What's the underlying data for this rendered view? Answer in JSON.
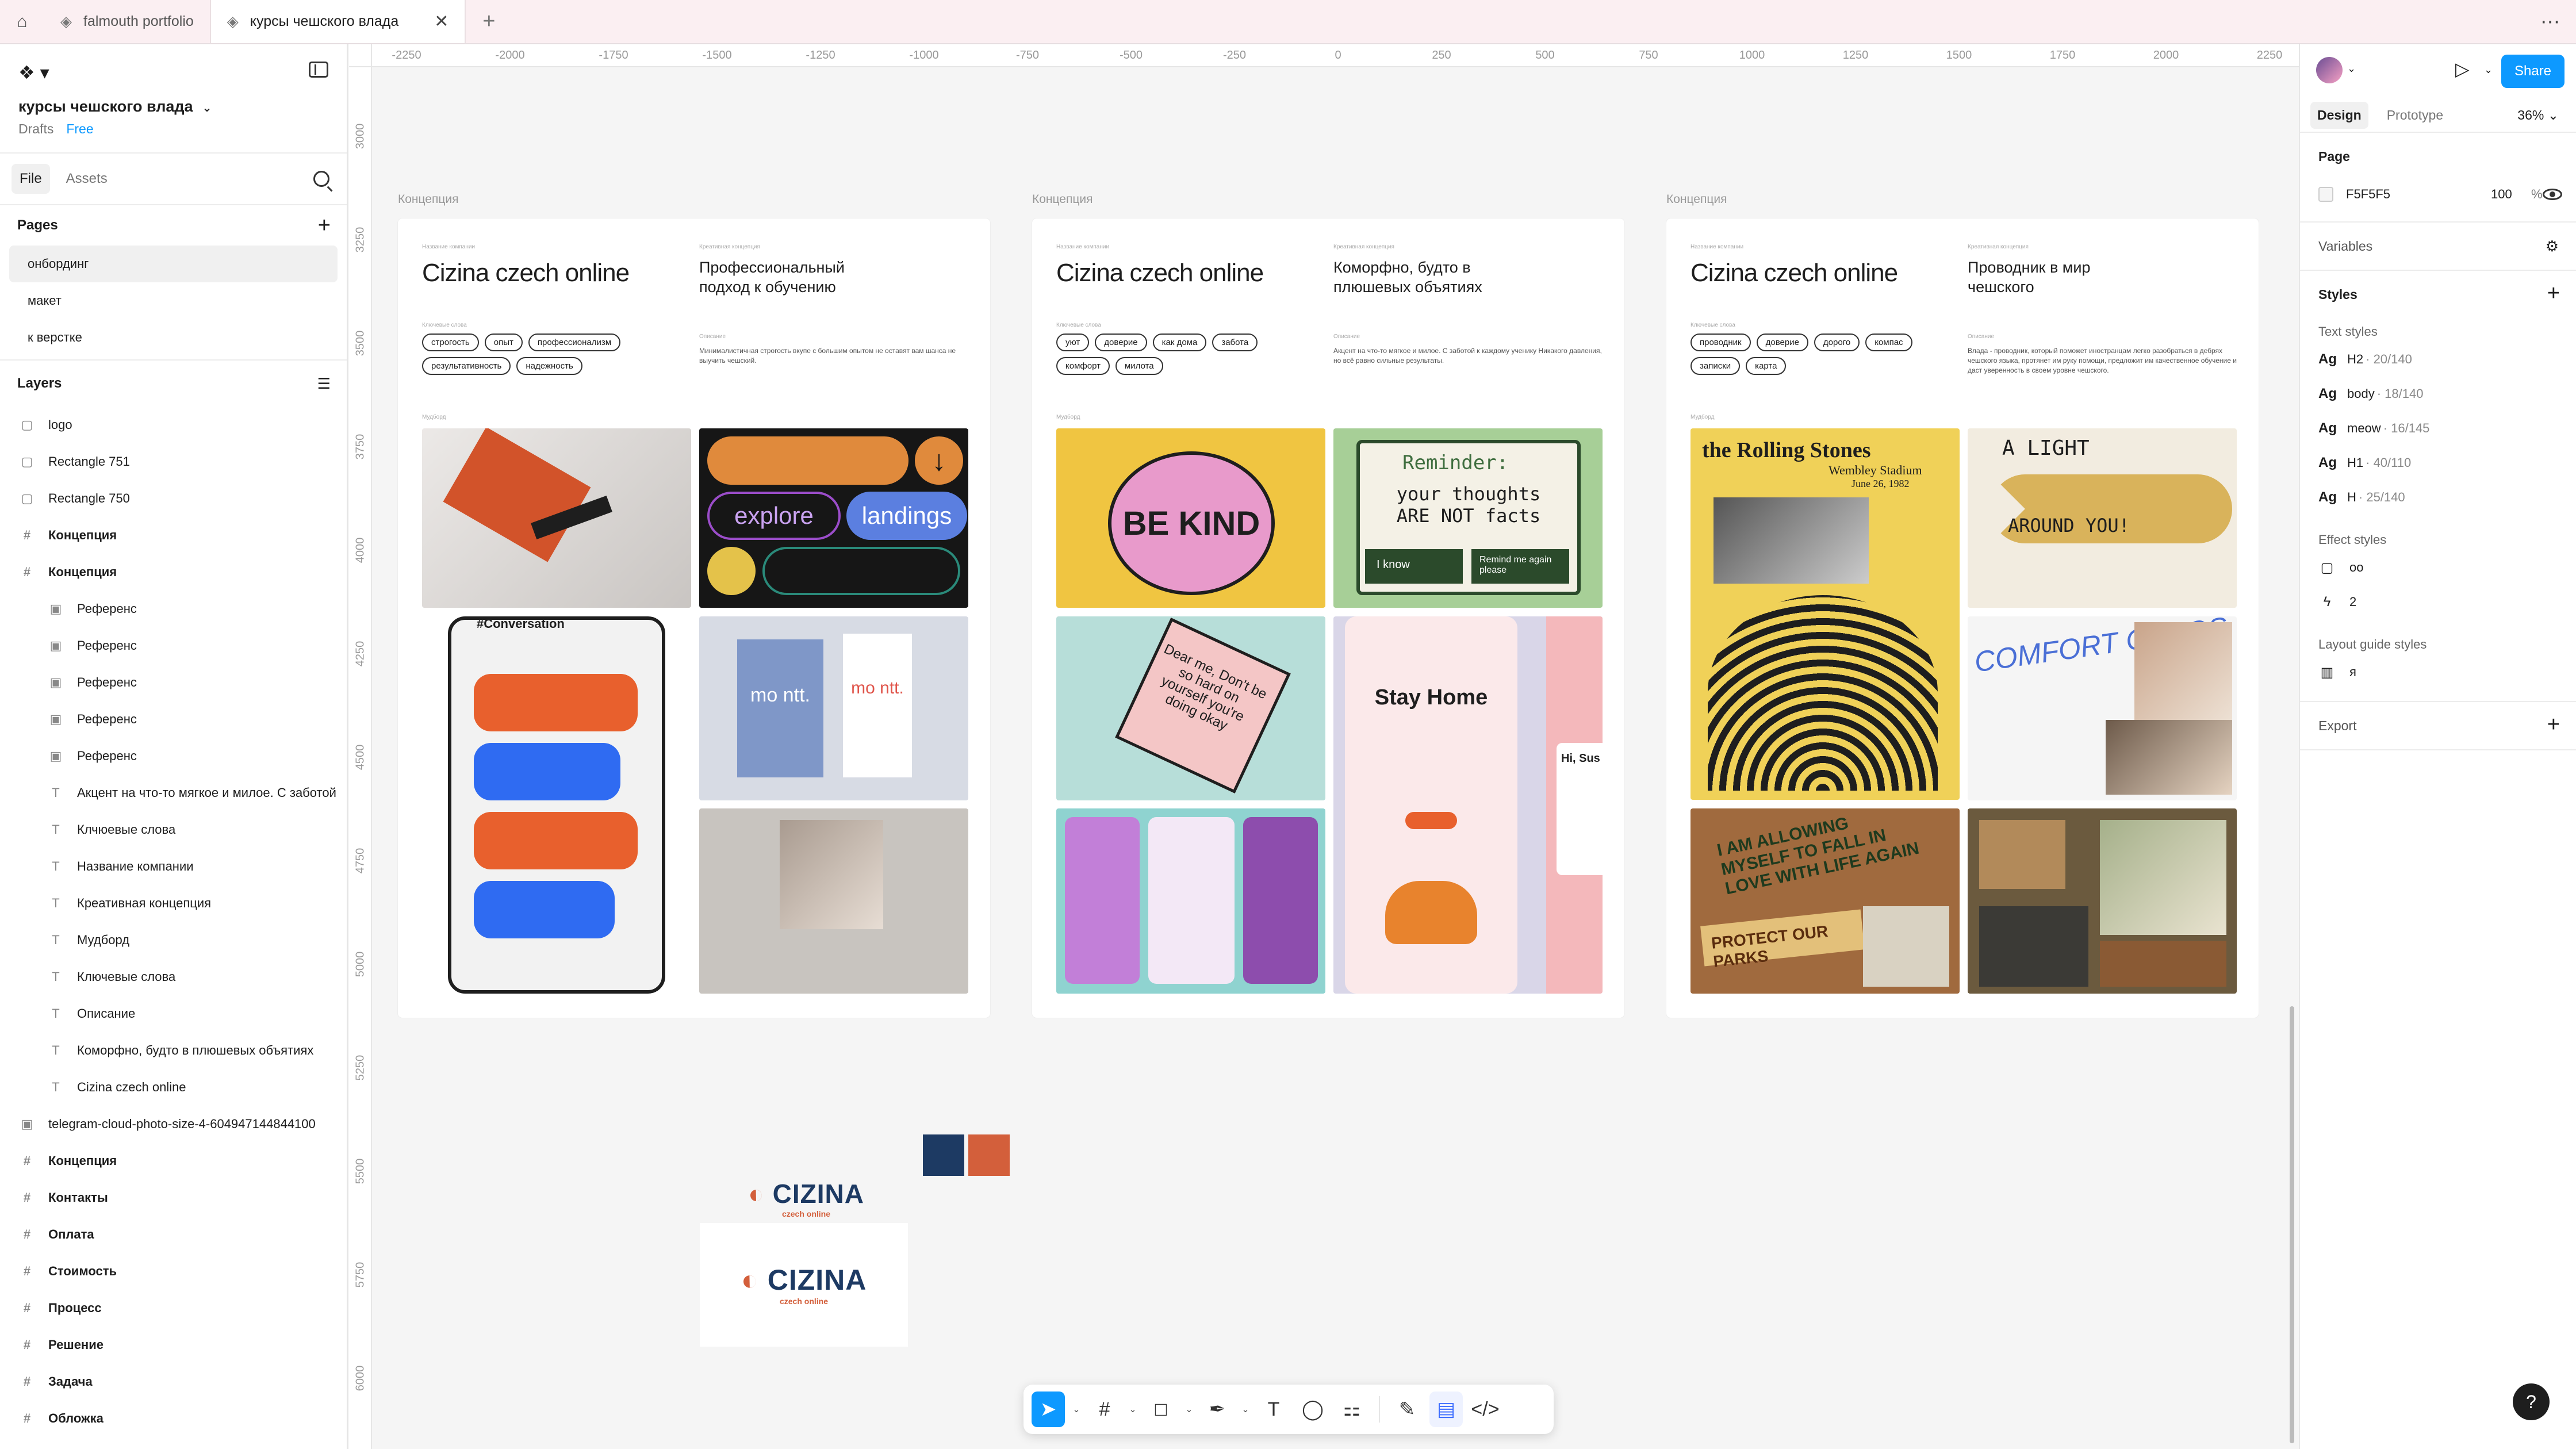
{
  "tabs": {
    "items": [
      {
        "label": "falmouth portfolio",
        "active": false
      },
      {
        "label": "курсы чешского влада",
        "active": true
      }
    ]
  },
  "file": {
    "title": "курсы чешского влада",
    "location": "Drafts",
    "plan": "Free"
  },
  "left_tabs": {
    "file": "File",
    "assets": "Assets"
  },
  "pages": {
    "title": "Pages",
    "items": [
      "онбординг",
      "макет",
      "к верстке"
    ]
  },
  "layers": {
    "title": "Layers",
    "items": [
      {
        "label": "logo",
        "type": "rect",
        "level": 0
      },
      {
        "label": "Rectangle 751",
        "type": "rect",
        "level": 0
      },
      {
        "label": "Rectangle 750",
        "type": "rect",
        "level": 0
      },
      {
        "label": "Концепция",
        "type": "frame",
        "level": 0
      },
      {
        "label": "Концепция",
        "type": "frame",
        "level": 0
      },
      {
        "label": "Референс",
        "type": "image",
        "level": 1
      },
      {
        "label": "Референс",
        "type": "image",
        "level": 1
      },
      {
        "label": "Референс",
        "type": "image",
        "level": 1
      },
      {
        "label": "Референс",
        "type": "image",
        "level": 1
      },
      {
        "label": "Референс",
        "type": "image",
        "level": 1
      },
      {
        "label": "Акцент на что-то мягкое и милое. С заботой",
        "type": "text",
        "level": 1
      },
      {
        "label": "Клчюевые слова",
        "type": "text",
        "level": 1
      },
      {
        "label": "Название компании",
        "type": "text",
        "level": 1
      },
      {
        "label": "Креативная концепция",
        "type": "text",
        "level": 1
      },
      {
        "label": "Мудборд",
        "type": "text",
        "level": 1
      },
      {
        "label": "Ключевые слова",
        "type": "text",
        "level": 1
      },
      {
        "label": "Описание",
        "type": "text",
        "level": 1
      },
      {
        "label": "Коморфно, будто в плюшевых объятиях",
        "type": "text",
        "level": 1
      },
      {
        "label": "Cizina czech online",
        "type": "text",
        "level": 1
      },
      {
        "label": "telegram-cloud-photo-size-4-604947144844100",
        "type": "image",
        "level": 0
      },
      {
        "label": "Концепция",
        "type": "frame",
        "level": 0
      },
      {
        "label": "Контакты",
        "type": "frame",
        "level": 0
      },
      {
        "label": "Оплата",
        "type": "frame",
        "level": 0
      },
      {
        "label": "Стоимость",
        "type": "frame",
        "level": 0
      },
      {
        "label": "Процесс",
        "type": "frame",
        "level": 0
      },
      {
        "label": "Решение",
        "type": "frame",
        "level": 0
      },
      {
        "label": "Задача",
        "type": "frame",
        "level": 0
      },
      {
        "label": "Обложка",
        "type": "frame",
        "level": 0
      }
    ]
  },
  "right": {
    "share": "Share",
    "tab_design": "Design",
    "tab_prototype": "Prototype",
    "zoom": "36%",
    "page_title": "Page",
    "page_fill": "F5F5F5",
    "page_opacity": "100",
    "page_opacity_unit": "%",
    "variables": "Variables",
    "styles": "Styles",
    "text_styles_title": "Text styles",
    "text_styles": [
      {
        "ag": "Ag",
        "name": "H2",
        "dim": "· 20/140"
      },
      {
        "ag": "Ag",
        "name": "body",
        "dim": "· 18/140"
      },
      {
        "ag": "Ag",
        "name": "meow",
        "dim": "· 16/145"
      },
      {
        "ag": "Ag",
        "name": "H1",
        "dim": "· 40/110"
      },
      {
        "ag": "Ag",
        "name": "H",
        "dim": "· 25/140"
      }
    ],
    "effect_styles_title": "Effect styles",
    "effect_styles": [
      "oo",
      "2"
    ],
    "layout_guides_title": "Layout guide styles",
    "layout_guides": [
      "я"
    ],
    "export": "Export"
  },
  "ruler_h": [
    "-2250",
    "-2000",
    "-1750",
    "-1500",
    "-1250",
    "-1000",
    "-750",
    "-500",
    "-250",
    "0",
    "250",
    "500",
    "750",
    "1000",
    "1250",
    "1500",
    "1750",
    "2000",
    "2250"
  ],
  "ruler_v": [
    "3000",
    "3250",
    "3500",
    "3750",
    "4000",
    "4250",
    "4500",
    "4750",
    "5000",
    "5250",
    "5500",
    "5750",
    "6000"
  ],
  "concepts": [
    {
      "label": "Концепция",
      "company_label": "Название компании",
      "company": "Cizina czech online",
      "concept_label": "Креативная концепция",
      "concept": "Профессиональный подход к обучению",
      "keywords_label": "Ключевые слова",
      "keywords": [
        "строгость",
        "опыт",
        "профессионализм",
        "результативность",
        "надежность"
      ],
      "desc_label": "Описание",
      "desc": "Минималистичная строгость вкупе с большим опытом не оставят вам шанса не выучить чешский.",
      "mood_label": "Мудборд",
      "img_text": {
        "explore": "explore",
        "landings": "landings",
        "conv": "#Conversation",
        "montt": "mo ntt."
      }
    },
    {
      "label": "Концепция",
      "company_label": "Название компании",
      "company": "Cizina czech online",
      "concept_label": "Креативная концепция",
      "concept": "Коморфно, будто в плюшевых объятиях",
      "keywords_label": "Ключевые слова",
      "keywords": [
        "уют",
        "доверие",
        "как дома",
        "забота",
        "комфорт",
        "милота"
      ],
      "desc_label": "Описание",
      "desc": "Акцент на что-то мягкое и милое. С заботой к каждому ученику Никакого давления, но всё равно сильные результаты.",
      "mood_label": "Мудборд",
      "img_text": {
        "bekind": "BE KIND",
        "reminder": "Reminder:",
        "thoughts": "your thoughts ARE NOT facts",
        "iknow": "I know",
        "remind": "Remind me again please",
        "dear": "Dear me, Don't be so hard on yourself you're doing okay",
        "stay": "Stay Home",
        "hisu": "Hi, Sus"
      }
    },
    {
      "label": "Концепция",
      "company_label": "Название компании",
      "company": "Cizina czech online",
      "concept_label": "Креативная концепция",
      "concept": "Проводник в мир чешского",
      "keywords_label": "Ключевые слова",
      "keywords": [
        "проводник",
        "доверие",
        "дорого",
        "компас",
        "записки",
        "карта"
      ],
      "desc_label": "Описание",
      "desc": "Влада - проводник, который поможет иностранцам легко разобраться в дебрях чешского языка, протянет им руку помощи, предложит им качественное обучение и даст уверенность в своем уровне чешского.",
      "mood_label": "Мудборд",
      "img_text": {
        "stones": "the Rolling Stones",
        "wembley": "Wembley Stadium",
        "date": "June 26, 1982",
        "alight": "A LIGHT",
        "around": "AROUND YOU!",
        "comfort": "COMFORT CHAOS",
        "allowing": "I AM ALLOWING MYSELF TO FALL IN LOVE WITH LIFE AGAIN",
        "parks": "PROTECT OUR PARKS"
      }
    }
  ],
  "logo": {
    "main": "CIZINA",
    "sub": "czech online"
  },
  "colors": {
    "navy": "#1d3a63",
    "orange": "#d35f3b",
    "accent": "#0d99ff"
  },
  "toolbar": {
    "select": "move-icon",
    "frame": "frame-icon",
    "shape": "rectangle-icon",
    "pen": "pen-icon",
    "text": "T",
    "comment": "comment-icon",
    "actions": "actions-icon"
  },
  "help": "?"
}
